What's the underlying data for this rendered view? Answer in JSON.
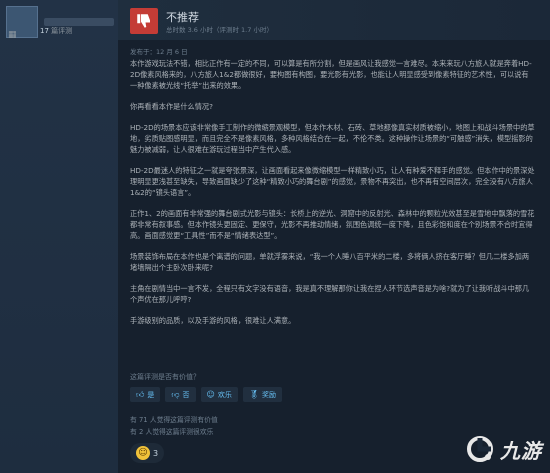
{
  "reviewer": {
    "review_count_number": "17",
    "review_count_label": "篇评测"
  },
  "review": {
    "recommendation": "不推荐",
    "hours": "总时数 3.6 小时（评测时 1.7 小时）",
    "posted": "发布于：12 月 6 日",
    "paragraphs": [
      "本作游戏玩法不错，相比正作有一定的不同，可以算是有所分割，但是画风让我感觉一言难尽。本来来玩八方旅人就是奔着HD-2D像素风格来的，八方旅人1&2都做很好，要构图有构图，要光影有光影，也能让人明显感受到像素特征的艺术性，可以说有一种像素被光线“托举”出来的效果。",
      "你再看看本作是什么情况?",
      "HD-2D的场景本应该非常像手工制作的微缩景观模型，但本作木材、石砖、草地都像真实材质被缩小，地图上和战斗场景中的草地，劣质贴图感明显，而且完全不是像素风格，多种风格结合在一起，不伦不类。这种操作让场景的“可触感”消失，模型摇影的魅力被减弱，让人很难在游玩过程当中产生代入感。",
      "HD-2D最迷人的特征之一就是夸张景深，让画面看起来像微缩模型一样精致小巧，让人有种爱不释手的感觉。但本作中的景深处理明显更浅甚至缺失，导致画面缺少了这种“精致小巧的舞台剧”的感觉，景物不再突出，也不再有空间层次，完全没有八方旅人1&2的“镜头语言”。",
      "正作1、2的画面有非常强的舞台剧式光影与镜头：长桥上的逆光、洞窟中的反射光、森林中的颗粒光效甚至是雪地中飘落的雪花都非常有叙事感。但本作镜头更固定、更保守，光影不再推动情绪，氛围色调统一度下降，且色彩饱和度在个别场景不合时宜得高。画面感觉更“工具性”而不是“情绪表达型”。",
      "场景装饰布局在本作也是个离谱的问题，单就浮雾来说，“我一个人睡八百平米的二楼，多将俩人挤在客厅睡？但几二楼多加两堵墙隔出个主卧次卧来呢?",
      "主角在剧情当中一言不发，全程只有文字没有语音，我是真不理解那你让我在捏人环节选声音是为啥?就为了让我听战斗中那几个声优在那儿呼哼?",
      "手游级别的品质，以及手游的风格，很难让人满意。"
    ],
    "helpful_question": "这篇评测是否有价值？",
    "votes": [
      {
        "icon": "thumbs-up-icon",
        "label": "是"
      },
      {
        "icon": "thumbs-down-icon",
        "label": "否"
      },
      {
        "icon": "smile-icon",
        "label": "欢乐"
      },
      {
        "icon": "award-icon",
        "label": "奖励"
      }
    ],
    "helpful_stat": "有 71 人觉得这篇评测有价值",
    "funny_stat": "有 2 人觉得这篇评测很欢乐",
    "award_count": "3"
  },
  "watermark": {
    "text": "九游"
  },
  "colors": {
    "thumb_red": "#c43c36",
    "link_blue": "#67c1f5",
    "bg": "#16202d"
  }
}
